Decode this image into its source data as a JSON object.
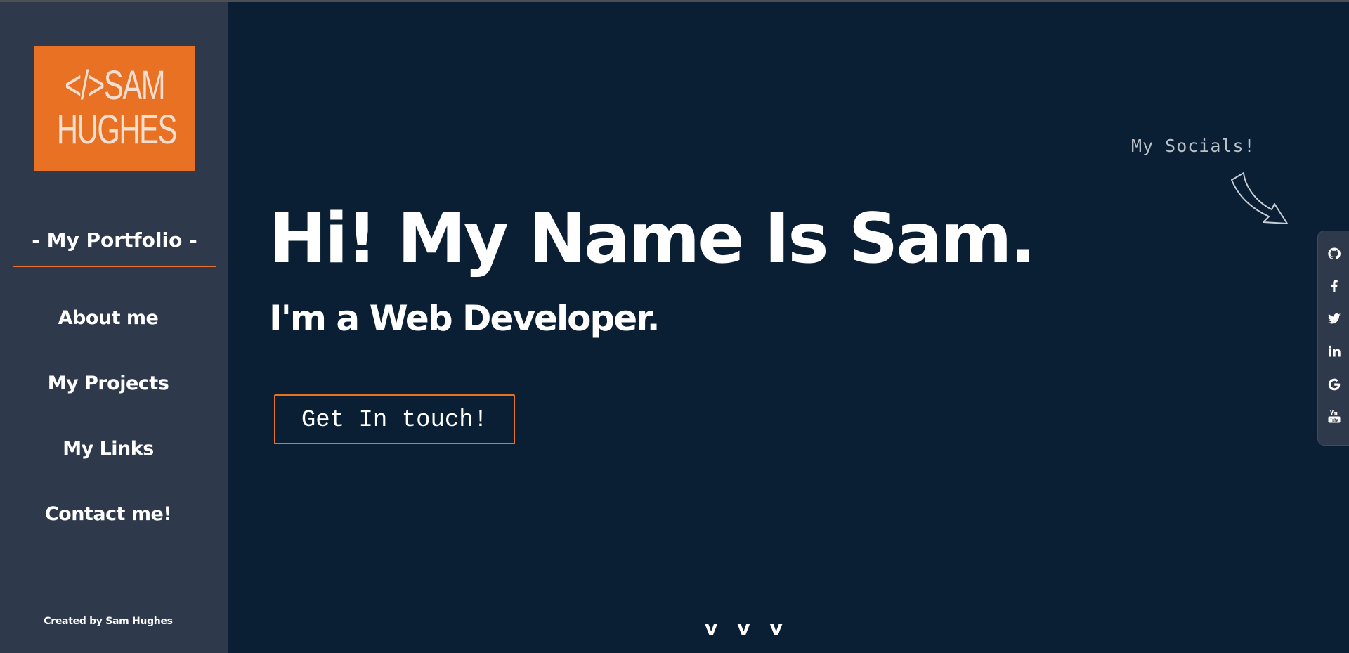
{
  "sidebar": {
    "logo": {
      "line1": "</>SAM",
      "line2": "HUGHES",
      "color": "#e87124"
    },
    "title": "- My Portfolio -",
    "nav": [
      {
        "label": "About me"
      },
      {
        "label": "My Projects"
      },
      {
        "label": "My Links"
      },
      {
        "label": "Contact me!"
      }
    ],
    "credit": "Created by Sam Hughes"
  },
  "hero": {
    "title": "Hi! My Name Is Sam.",
    "subtitle": "I'm a Web Developer.",
    "cta_label": "Get In touch!"
  },
  "socials": {
    "label": "My Socials!",
    "icons": [
      "github-icon",
      "facebook-icon",
      "twitter-icon",
      "linkedin-icon",
      "google-icon",
      "youtube-icon"
    ]
  },
  "scroll_hint": {
    "chevrons": [
      "v",
      "v",
      "v"
    ]
  },
  "colors": {
    "background": "#0a1f33",
    "sidebar": "#2e3a4b",
    "accent": "#e87124"
  }
}
